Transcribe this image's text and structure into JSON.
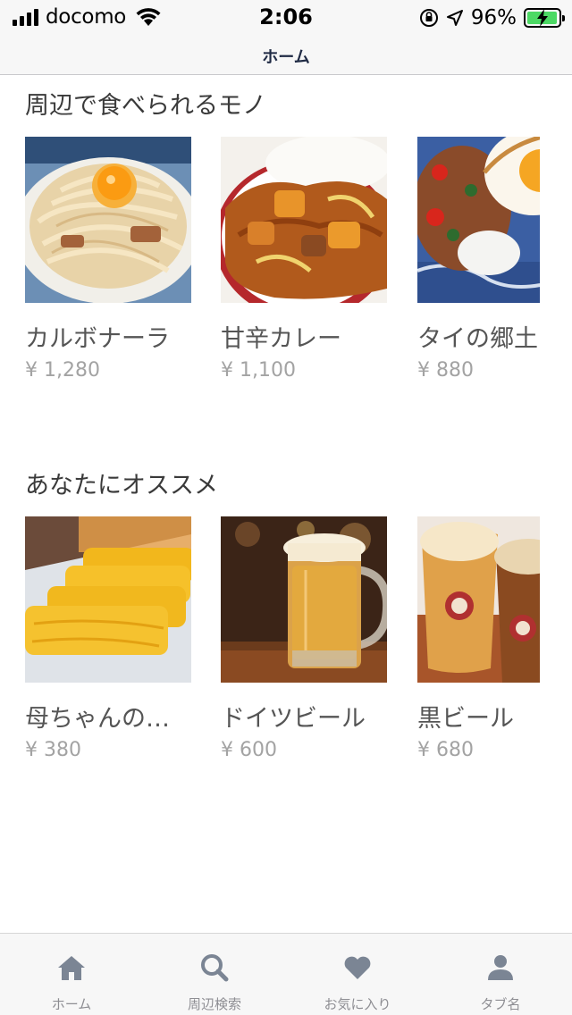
{
  "status_bar": {
    "carrier": "docomo",
    "time": "2:06",
    "battery_percent": "96%",
    "battery_level": 0.96,
    "battery_color": "#4cd964"
  },
  "nav": {
    "title": "ホーム"
  },
  "sections": [
    {
      "title": "周辺で食べられるモノ",
      "items": [
        {
          "name": "カルボナーラ",
          "price": "¥ 1,280",
          "image": "carbonara-photo"
        },
        {
          "name": "甘辛カレー",
          "price": "¥ 1,100",
          "image": "curry-photo"
        },
        {
          "name": "タイの郷土",
          "price": "¥ 880",
          "image": "thai-rice-photo"
        }
      ]
    },
    {
      "title": "あなたにオススメ",
      "items": [
        {
          "name": "母ちゃんの出…",
          "price": "¥ 380",
          "image": "tamagoyaki-photo"
        },
        {
          "name": "ドイツビール",
          "price": "¥ 600",
          "image": "german-beer-photo"
        },
        {
          "name": "黒ビール",
          "price": "¥ 680",
          "image": "dark-beer-photo"
        }
      ]
    }
  ],
  "tabs": [
    {
      "label": "ホーム",
      "icon": "home-icon"
    },
    {
      "label": "周辺検索",
      "icon": "search-icon"
    },
    {
      "label": "お気に入り",
      "icon": "heart-icon"
    },
    {
      "label": "タブ名",
      "icon": "person-icon"
    }
  ],
  "colors": {
    "tab_icon": "#7b8594",
    "price": "#a3a3a3",
    "nav_title": "#1f2a44"
  }
}
